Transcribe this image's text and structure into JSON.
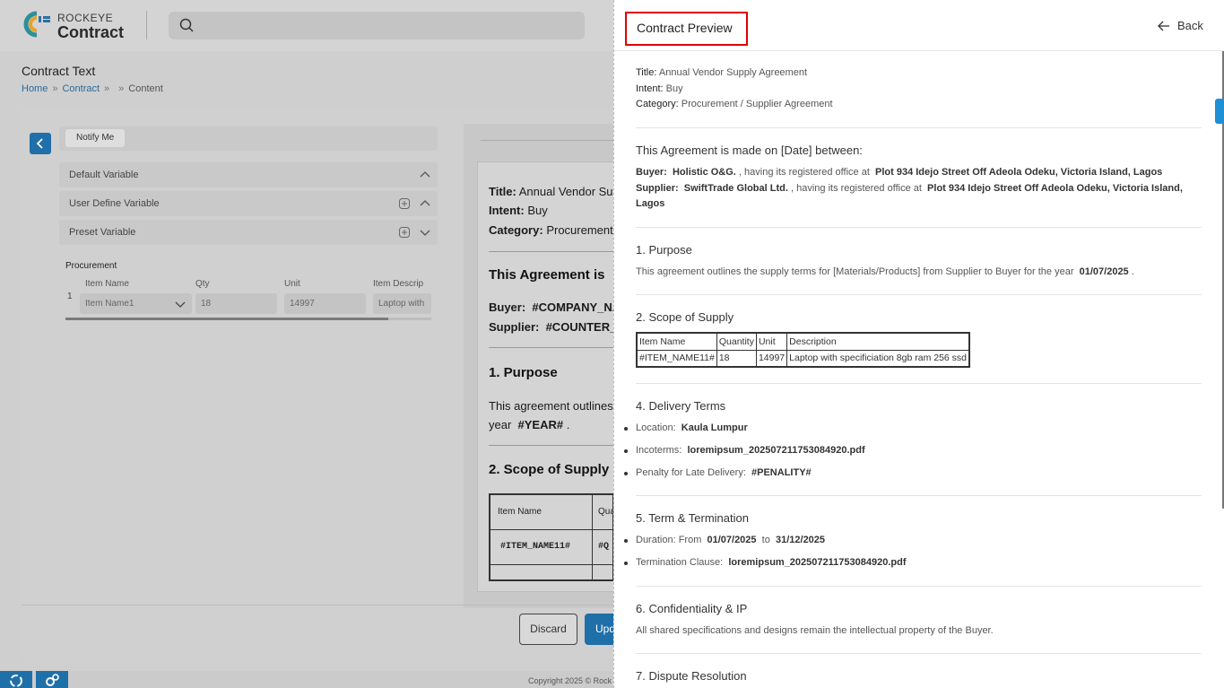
{
  "app": {
    "brand_top": "ROCKEYE",
    "brand_bottom": "Contract",
    "colors": {
      "primary": "#1f6fa8",
      "highlight": "#e00000"
    }
  },
  "page": {
    "title": "Contract Text",
    "breadcrumb": [
      "Home",
      "Contract",
      "",
      "Content"
    ],
    "breadcrumb_sep": "»"
  },
  "sidebar": {
    "notify": "Notify Me",
    "accordions": [
      "Default Variable",
      "User Define Variable",
      "Preset Variable"
    ],
    "procurement": {
      "label": "Procurement",
      "row_number": "1",
      "headers": [
        "Item Name",
        "Qty",
        "Unit",
        "Item Descrip"
      ],
      "values": [
        "Item Name1",
        "18",
        "14997",
        "Laptop with"
      ]
    }
  },
  "editor": {
    "title_label": "Title:",
    "title_value": "Annual Vendor Sup",
    "intent_label": "Intent:",
    "intent_value": "Buy",
    "category_label": "Category:",
    "category_value": "Procurement",
    "heading": "This Agreement is",
    "buyer_label": "Buyer:",
    "buyer_value": "#COMPANY_NA",
    "supplier_label": "Supplier:",
    "supplier_value": "#COUNTER_P",
    "purpose_heading": "1. Purpose",
    "purpose_line1": "This agreement outlines",
    "purpose_line2_prefix": "year",
    "purpose_line2_var": "#YEAR#",
    "purpose_line2_suffix": ".",
    "scope_heading": "2. Scope of Supply",
    "table_header_1": "Item Name",
    "table_header_2": "Qua",
    "table_cell_1": "#ITEM_NAME11#",
    "table_cell_2": "#Q"
  },
  "footer": {
    "discard": "Discard",
    "update": "Upd",
    "copyright": "Copyright 2025 © Rock"
  },
  "preview": {
    "title": "Contract Preview",
    "back": "Back",
    "meta": {
      "title_label": "Title:",
      "title_value": "Annual Vendor Supply Agreement",
      "intent_label": "Intent:",
      "intent_value": "Buy",
      "category_label": "Category:",
      "category_value": "Procurement / Supplier Agreement"
    },
    "agreement_heading": "This Agreement is made on [Date] between:",
    "buyer": {
      "label": "Buyer:",
      "name": "Holistic O&G.",
      "middle": ", having its registered office at",
      "address": "Plot 934 Idejo Street Off Adeola Odeku, Victoria Island, Lagos"
    },
    "supplier": {
      "label": "Supplier:",
      "name": "SwiftTrade Global Ltd.",
      "middle": ", having its registered office at",
      "address": "Plot 934 Idejo Street Off Adeola Odeku, Victoria Island, Lagos"
    },
    "purpose": {
      "heading": "1. Purpose",
      "text": "This agreement outlines the supply terms for [Materials/Products] from Supplier to Buyer for the year",
      "year": "01/07/2025",
      "suffix": "."
    },
    "scope": {
      "heading": "2. Scope of Supply",
      "columns": [
        "Item Name",
        "Quantity",
        "Unit",
        "Description"
      ],
      "row": [
        "#ITEM_NAME11#",
        "18",
        "14997",
        "Laptop with specificiation 8gb ram 256 ssd"
      ]
    },
    "delivery": {
      "heading": "4. Delivery Terms",
      "location_label": "Location:",
      "location_value": "Kaula Lumpur",
      "incoterms_label": "Incoterms:",
      "incoterms_value": "loremipsum_202507211753084920.pdf",
      "penalty_label": "Penalty for Late Delivery:",
      "penalty_value": "#PENALITY#"
    },
    "term": {
      "heading": "5. Term & Termination",
      "duration_label": "Duration: From",
      "duration_from": "01/07/2025",
      "duration_to_word": "to",
      "duration_to": "31/12/2025",
      "termination_label": "Termination Clause:",
      "termination_value": "loremipsum_202507211753084920.pdf"
    },
    "confidentiality": {
      "heading": "6. Confidentiality & IP",
      "text": "All shared specifications and designs remain the intellectual property of the Buyer."
    },
    "dispute": {
      "heading": "7. Dispute Resolution"
    }
  }
}
